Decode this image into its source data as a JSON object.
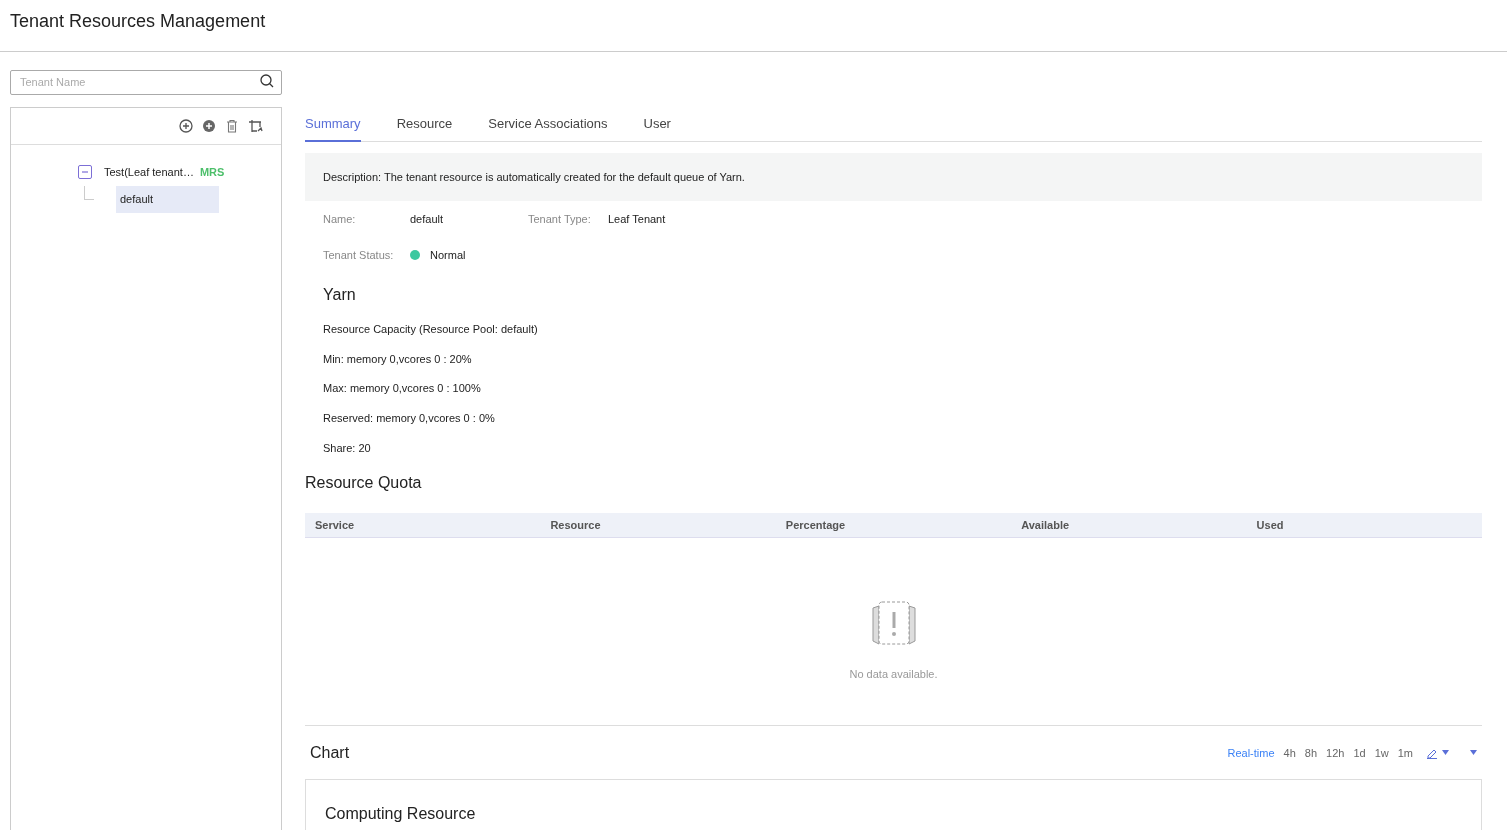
{
  "page_title": "Tenant Resources Management",
  "search": {
    "placeholder": "Tenant Name"
  },
  "tree": [
    {
      "label": "Test(Leaf tenant…",
      "tag": "MRS",
      "expanded": true,
      "selected": false,
      "children": [
        {
          "label": "default",
          "selected": true
        }
      ]
    }
  ],
  "tabs": [
    {
      "label": "Summary",
      "selected": true
    },
    {
      "label": "Resource",
      "selected": false
    },
    {
      "label": "Service Associations",
      "selected": false
    },
    {
      "label": "User",
      "selected": false
    }
  ],
  "description": "Description: The tenant resource is automatically created for the default queue of Yarn.",
  "fields": [
    {
      "label": "Name:",
      "value": "default"
    },
    {
      "label": "Tenant Type:",
      "value": "Leaf Tenant"
    }
  ],
  "status": {
    "label": "Tenant Status:",
    "value": "Normal",
    "color": "#3cc8a0"
  },
  "yarn": {
    "title": "Yarn",
    "lines": [
      "Resource Capacity (Resource Pool: default)",
      "Min: memory 0,vcores 0 : 20%",
      "Max: memory 0,vcores 0 : 100%",
      "Reserved: memory 0,vcores 0 : 0%",
      "Share: 20"
    ]
  },
  "quota": {
    "title": "Resource Quota",
    "columns": [
      "Service",
      "Resource",
      "Percentage",
      "Available",
      "Used"
    ],
    "empty": "No data available."
  },
  "chart": {
    "title": "Chart",
    "ranges": [
      {
        "label": "Real-time",
        "selected": true
      },
      {
        "label": "4h",
        "selected": false
      },
      {
        "label": "8h",
        "selected": false
      },
      {
        "label": "12h",
        "selected": false
      },
      {
        "label": "1d",
        "selected": false
      },
      {
        "label": "1w",
        "selected": false
      },
      {
        "label": "1m",
        "selected": false
      }
    ],
    "panel_title": "Computing Resource"
  }
}
